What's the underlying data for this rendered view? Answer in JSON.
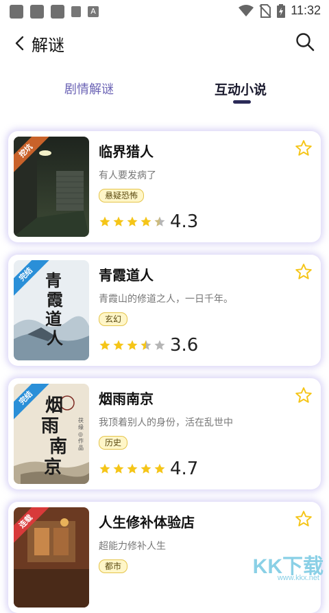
{
  "status_bar": {
    "time": "11:32"
  },
  "header": {
    "title": "解谜"
  },
  "tabs": [
    {
      "label": "剧情解谜",
      "active": false
    },
    {
      "label": "互动小说",
      "active": true
    }
  ],
  "books": [
    {
      "name": "临界猎人",
      "desc": "有人要发病了",
      "tag": "悬疑恐怖",
      "rating": "4.3",
      "rating_value": 4.3,
      "badge": "挖坑",
      "badge_color": "#c8622a"
    },
    {
      "name": "青霞道人",
      "desc": "青霞山的修道之人，一日千年。",
      "tag": "玄幻",
      "rating": "3.6",
      "rating_value": 3.6,
      "badge": "完结",
      "badge_color": "#2a8fd8"
    },
    {
      "name": "烟雨南京",
      "desc": "我顶着别人的身份，活在乱世中",
      "tag": "历史",
      "rating": "4.7",
      "rating_value": 4.7,
      "badge": "完结",
      "badge_color": "#2a8fd8"
    },
    {
      "name": "人生修补体验店",
      "desc": "超能力修补人生",
      "tag": "都市",
      "rating": "",
      "rating_value": null,
      "badge": "连载",
      "badge_color": "#d83a3a"
    }
  ],
  "colors": {
    "accent": "#6b63b5",
    "star": "#f5c518",
    "card_shadow": "#aaa0eb"
  },
  "watermark": {
    "big": "KK下载",
    "small": "www.kkx.net"
  }
}
